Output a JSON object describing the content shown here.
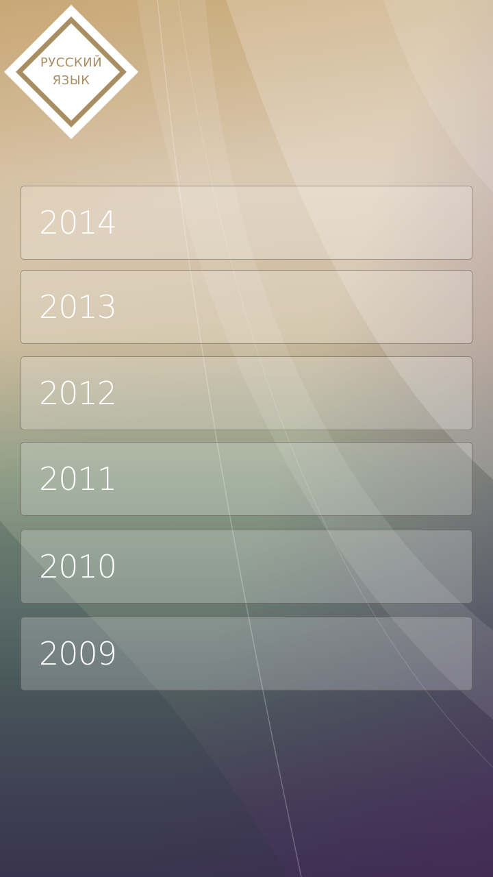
{
  "app": {
    "logo_line1": "РУССКИЙ",
    "logo_line2": "ЯЗЫК",
    "logo_icon": "diamond-logo-icon"
  },
  "years": {
    "items": [
      {
        "label": "2014"
      },
      {
        "label": "2013"
      },
      {
        "label": "2012"
      },
      {
        "label": "2011"
      },
      {
        "label": "2010"
      },
      {
        "label": "2009"
      }
    ]
  },
  "colors": {
    "logo_gold": "#a98e63",
    "item_text": "#ffffff"
  }
}
